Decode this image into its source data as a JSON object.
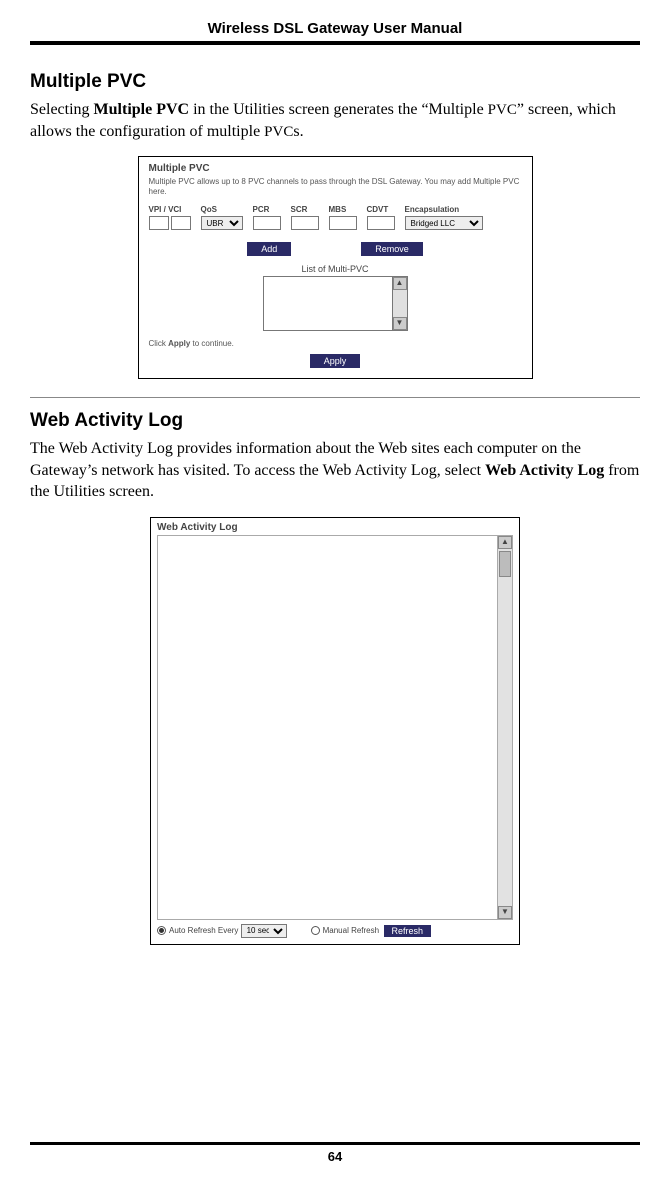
{
  "header": {
    "title": "Wireless DSL Gateway User Manual"
  },
  "section1": {
    "heading": "Multiple PVC",
    "para_pre": "Selecting ",
    "para_bold1": "Multiple PVC",
    "para_mid1": " in the Utilities screen generates the “Multiple ",
    "para_sc1": "PVC",
    "para_mid2": "” screen, which allows the configuration of multiple ",
    "para_sc2": "PVC",
    "para_end": "s."
  },
  "pvc_shot": {
    "title": "Multiple PVC",
    "desc": "Multiple PVC allows up to 8 PVC channels to pass through the DSL Gateway. You may add Multiple PVC here.",
    "cols": {
      "vpi_vci": "VPI / VCI",
      "qos": "QoS",
      "pcr": "PCR",
      "scr": "SCR",
      "mbs": "MBS",
      "cdvt": "CDVT",
      "encap": "Encapsulation"
    },
    "qos_value": "UBR",
    "encap_value": "Bridged LLC",
    "btn_add": "Add",
    "btn_remove": "Remove",
    "list_label": "List of Multi-PVC",
    "hint_pre": "Click ",
    "hint_bold": "Apply",
    "hint_post": " to continue.",
    "btn_apply": "Apply"
  },
  "section2": {
    "heading": "Web Activity Log",
    "para_pre": "The Web Activity Log provides information about the Web sites each computer on the Gateway’s network has visited. To access the Web Activity Log, select ",
    "para_bold": "Web Activity Log",
    "para_post": " from the Utilities screen."
  },
  "log_shot": {
    "title": "Web Activity Log",
    "auto_label_pre": "Auto Refresh Every",
    "auto_value": "10 sec",
    "manual_label": "Manual Refresh",
    "btn_refresh": "Refresh"
  },
  "footer": {
    "page": "64"
  }
}
